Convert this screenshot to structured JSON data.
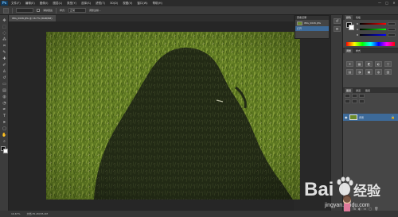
{
  "app": {
    "logo": "Ps"
  },
  "menubar": {
    "items": [
      "文件(F)",
      "编辑(E)",
      "图像(I)",
      "图层(L)",
      "类型(Y)",
      "选择(S)",
      "滤镜(T)",
      "3D(D)",
      "视图(V)",
      "窗口(W)",
      "帮助(H)"
    ],
    "window_controls": [
      "—",
      "□",
      "✕"
    ]
  },
  "options_bar": {
    "size_value": "",
    "antialias_label": "消除锯齿",
    "style_label": "样式:",
    "style_value": "正常",
    "edge_label": "调整边缘..."
  },
  "document": {
    "tab_title": "IMG_0026.JPG @ 16.7% (RGB/8#)"
  },
  "history_panel": {
    "title": "历史记录",
    "rows": [
      "IMG_0026.JPG",
      "打开"
    ]
  },
  "right_panels": {
    "color_tabs": [
      "颜色",
      "色板"
    ],
    "channels": [
      "R",
      "G",
      "B"
    ],
    "adj_tabs": [
      "调整",
      "样式"
    ],
    "adj_icons": [
      "☀",
      "▦",
      "◩",
      "◐",
      "▽",
      "▤",
      "◑",
      "▣",
      "◍",
      "▥"
    ],
    "layers_tabs": [
      "图层",
      "通道",
      "路径"
    ],
    "layer_name": "背景",
    "footer_icons": [
      "∞",
      "fx",
      "◐",
      "▭",
      "▢",
      "🗑"
    ]
  },
  "statusbar": {
    "zoom": "16.67%",
    "doc_info": "文档:35.2M/35.2M"
  },
  "watermark": {
    "brand": "Bai",
    "brand_suffix": "经验",
    "url": "jingyan.baidu.com"
  },
  "colors": {
    "accent_selection": "#3d6a99",
    "grass": "#6a8a2a",
    "shadow": "#1d2410"
  }
}
